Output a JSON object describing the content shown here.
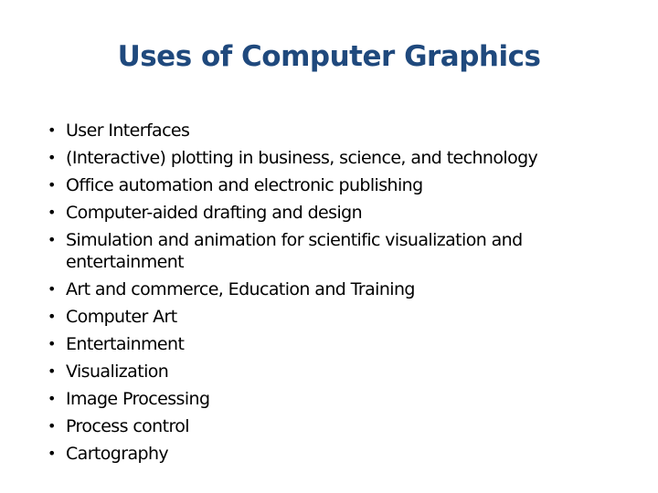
{
  "slide": {
    "title": "Uses of Computer Graphics",
    "bullet_icon": "•",
    "items": [
      {
        "text": "User Interfaces"
      },
      {
        "text": "(Interactive) plotting in business, science, and technology"
      },
      {
        "text": "Office automation and electronic publishing"
      },
      {
        "text": "Computer-aided drafting and design"
      },
      {
        "text": "Simulation and animation for scientific visualization and entertainment"
      },
      {
        "text": "Art and commerce, Education and Training"
      },
      {
        "text": "Computer Art"
      },
      {
        "text": "Entertainment"
      },
      {
        "text": "Visualization"
      },
      {
        "text": "Image Processing"
      },
      {
        "text": "Process control"
      },
      {
        "text": "Cartography"
      }
    ]
  }
}
